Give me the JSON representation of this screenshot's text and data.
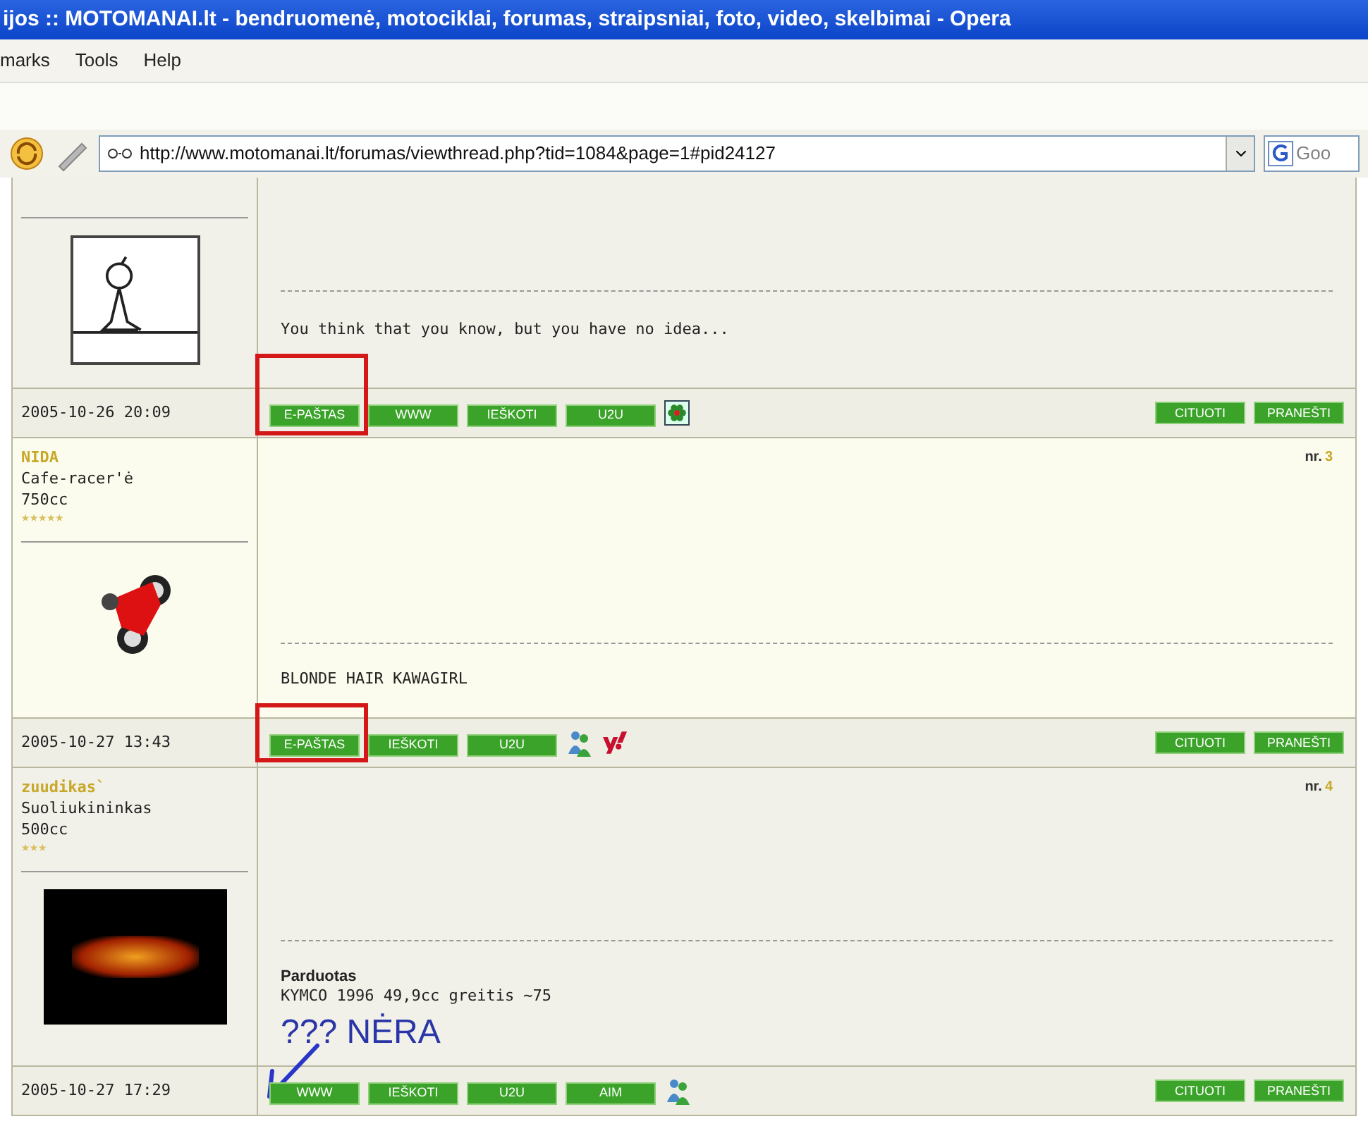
{
  "window": {
    "title": "ijos :: MOTOMANAI.lt - bendruomenė, motociklai, forumas, straipsniai, foto, video, skelbimai - Opera"
  },
  "menu": [
    "marks",
    "Tools",
    "Help"
  ],
  "address_bar": {
    "url": "http://www.motomanai.lt/forumas/viewthread.php?tid=1084&page=1#pid24127",
    "search_placeholder": "Goo"
  },
  "posts": [
    {
      "avatar": {
        "kind": "sketch"
      },
      "signature": [
        {
          "text": "You think that you know, but you have no idea...",
          "bold": false
        }
      ],
      "date": "2005-10-26 20:09",
      "left_buttons": [
        {
          "kind": "button",
          "label": "E-PAŠTAS",
          "circled": true
        },
        {
          "kind": "button",
          "label": "WWW",
          "circled": false
        },
        {
          "kind": "button",
          "label": "IEŠKOTI",
          "circled": false
        },
        {
          "kind": "button",
          "label": "U2U",
          "circled": false
        },
        {
          "kind": "icq"
        }
      ],
      "right_buttons": [
        "CITUOTI",
        "PRANEŠTI"
      ]
    },
    {
      "author": "NIDA",
      "rank": "Cafe-racer'ė",
      "cc": "750cc",
      "stars": 5,
      "avatar": {
        "kind": "motorcycle"
      },
      "number_label": "nr.",
      "number": "3",
      "signature": [
        {
          "text": "BLONDE HAIR KAWAGIRL",
          "bold": false
        }
      ],
      "date": "2005-10-27 13:43",
      "left_buttons": [
        {
          "kind": "button",
          "label": "E-PAŠTAS",
          "circled": true
        },
        {
          "kind": "button",
          "label": "IEŠKOTI",
          "circled": false
        },
        {
          "kind": "button",
          "label": "U2U",
          "circled": false
        },
        {
          "kind": "msn"
        },
        {
          "kind": "yahoo"
        }
      ],
      "right_buttons": [
        "CITUOTI",
        "PRANEŠTI"
      ]
    },
    {
      "author": "zuudikas`",
      "rank": "Suoliukininkas",
      "cc": "500cc",
      "stars": 3,
      "avatar": {
        "kind": "banner"
      },
      "number_label": "nr.",
      "number": "4",
      "signature": [
        {
          "text": "Parduotas",
          "bold": true
        },
        {
          "text": "KYMCO 1996 49,9cc greitis ~75",
          "bold": false
        }
      ],
      "note": "??? NĖRA",
      "note_arrow": true,
      "date": "2005-10-27 17:29",
      "left_buttons": [
        {
          "kind": "button",
          "label": "WWW",
          "circled": false
        },
        {
          "kind": "button",
          "label": "IEŠKOTI",
          "circled": false
        },
        {
          "kind": "button",
          "label": "U2U",
          "circled": false
        },
        {
          "kind": "button",
          "label": "AIM",
          "circled": false
        },
        {
          "kind": "msn"
        }
      ],
      "right_buttons": [
        "CITUOTI",
        "PRANEŠTI"
      ]
    }
  ]
}
